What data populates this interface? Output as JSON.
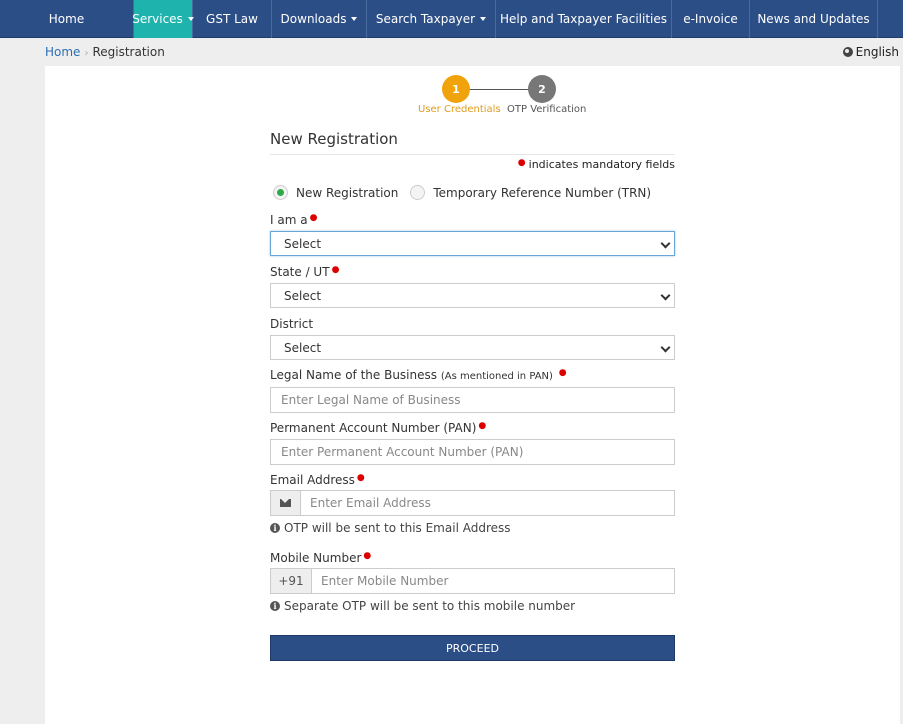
{
  "nav": {
    "items": [
      {
        "label": "Home",
        "dropdown": false,
        "active": false
      },
      {
        "label": "Services",
        "dropdown": true,
        "active": true
      },
      {
        "label": "GST Law",
        "dropdown": false,
        "active": false
      },
      {
        "label": "Downloads",
        "dropdown": true,
        "active": false
      },
      {
        "label": "Search Taxpayer",
        "dropdown": true,
        "active": false
      },
      {
        "label": "Help and Taxpayer Facilities",
        "dropdown": false,
        "active": false
      },
      {
        "label": "e-Invoice",
        "dropdown": false,
        "active": false
      },
      {
        "label": "News and Updates",
        "dropdown": false,
        "active": false
      }
    ]
  },
  "breadcrumb": {
    "home": "Home",
    "current": "Registration"
  },
  "language": "English",
  "stepper": {
    "steps": [
      {
        "number": "1",
        "label": "User Credentials",
        "status": "active"
      },
      {
        "number": "2",
        "label": "OTP Verification",
        "status": "pending"
      }
    ]
  },
  "form": {
    "title": "New Registration",
    "mandatory_note": "indicates mandatory fields",
    "radio_new": "New Registration",
    "radio_trn": "Temporary Reference Number (TRN)",
    "iam_label": "I am a",
    "iam_value": "Select",
    "state_label": "State / UT",
    "state_value": "Select",
    "district_label": "District",
    "district_value": "Select",
    "legal_name_label": "Legal Name of the Business",
    "legal_name_note": "(As mentioned in PAN)",
    "legal_name_placeholder": "Enter Legal Name of Business",
    "pan_label": "Permanent Account Number (PAN)",
    "pan_placeholder": "Enter Permanent Account Number (PAN)",
    "email_label": "Email Address",
    "email_placeholder": "Enter Email Address",
    "email_hint": "OTP will be sent to this Email Address",
    "mobile_label": "Mobile Number",
    "mobile_prefix": "+91",
    "mobile_placeholder": "Enter Mobile Number",
    "mobile_hint": "Separate OTP will be sent to this mobile number",
    "proceed": "PROCEED"
  },
  "colors": {
    "nav_bg": "#2c4e86",
    "nav_active": "#1fb3ad",
    "step_active": "#f0a30a",
    "step_pending": "#777777",
    "required": "#dd0000",
    "radio_checked": "#2da84a"
  }
}
